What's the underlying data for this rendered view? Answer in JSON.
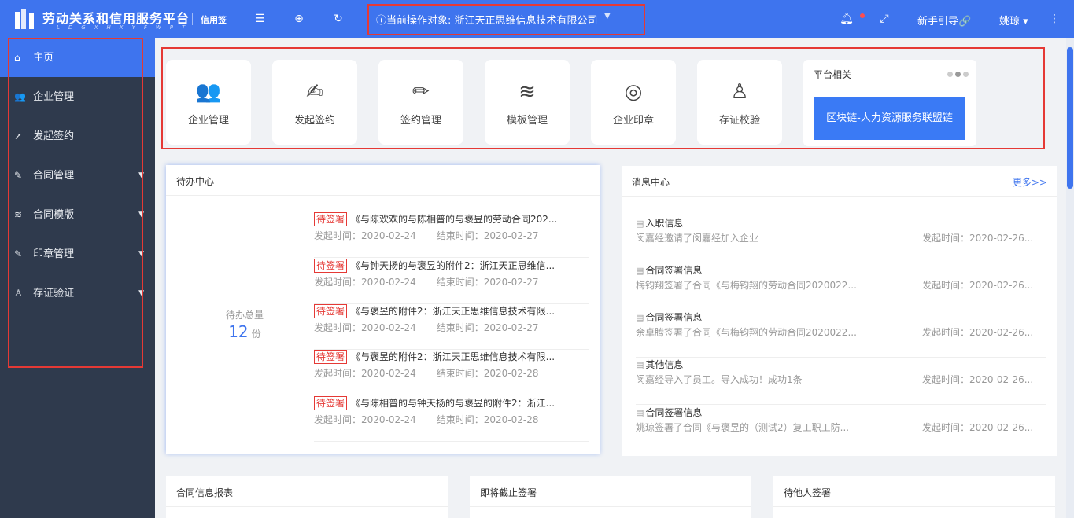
{
  "header": {
    "brand": "劳动关系和信用服务平台",
    "brand_sub": "LDGXHXYFWPT",
    "tag": "信用签",
    "target_label": "ⓘ当前操作对象:  浙江天正思维信息技术有限公司",
    "guide": "新手引导🔗",
    "user": "姚琼 ▾",
    "icons": [
      "menu-icon",
      "globe-icon",
      "refresh-icon",
      "bell-icon",
      "fullscreen-icon",
      "more-icon"
    ],
    "accent_color": "#3e74ee"
  },
  "sidebar": {
    "items": [
      {
        "label": "主页",
        "icon": "⌂"
      },
      {
        "label": "企业管理",
        "icon": "👥"
      },
      {
        "label": "发起签约",
        "icon": "➚"
      },
      {
        "label": "合同管理",
        "icon": "✎"
      },
      {
        "label": "合同模版",
        "icon": "≋"
      },
      {
        "label": "印章管理",
        "icon": "✎"
      },
      {
        "label": "存证验证",
        "icon": "♙"
      }
    ]
  },
  "quick": {
    "cards": [
      {
        "label": "企业管理",
        "icon": "👥"
      },
      {
        "label": "发起签约",
        "icon": "✍"
      },
      {
        "label": "签约管理",
        "icon": "✏"
      },
      {
        "label": "模板管理",
        "icon": "≋"
      },
      {
        "label": "企业印章",
        "icon": "◎"
      },
      {
        "label": "存证校验",
        "icon": "♙"
      }
    ],
    "platform_title": "平台相关",
    "platform_button": "区块链-人力资源服务联盟链"
  },
  "todo": {
    "title": "待办中心",
    "total_label": "待办总量",
    "total_count": "12",
    "unit": "份",
    "badge": "待签署",
    "items": [
      {
        "title": "《与陈欢欢的与陈相普的与褒昱的劳动合同202...",
        "start": "发起时间：2020-02-24",
        "end": "结束时间：2020-02-27"
      },
      {
        "title": "《与钟天扬的与褒昱的附件2：浙江天正思维信...",
        "start": "发起时间：2020-02-24",
        "end": "结束时间：2020-02-27"
      },
      {
        "title": "《与褒昱的附件2：浙江天正思维信息技术有限...",
        "start": "发起时间：2020-02-24",
        "end": "结束时间：2020-02-27"
      },
      {
        "title": "《与褒昱的附件2：浙江天正思维信息技术有限...",
        "start": "发起时间：2020-02-24",
        "end": "结束时间：2020-02-28"
      },
      {
        "title": "《与陈相普的与钟天扬的与褒昱的附件2：浙江...",
        "start": "发起时间：2020-02-24",
        "end": "结束时间：2020-02-28"
      }
    ]
  },
  "messages": {
    "title": "消息中心",
    "more": "更多>>",
    "items": [
      {
        "title": "入职信息",
        "desc": "闵嘉经邀请了闵嘉经加入企业",
        "time": "发起时间：2020-02-26..."
      },
      {
        "title": "合同签署信息",
        "desc": "梅钧翔签署了合同《与梅钧翔的劳动合同2020022...",
        "time": "发起时间：2020-02-26..."
      },
      {
        "title": "合同签署信息",
        "desc": "余卓腾签署了合同《与梅钧翔的劳动合同2020022...",
        "time": "发起时间：2020-02-26..."
      },
      {
        "title": "其他信息",
        "desc": "闵嘉经导入了员工。导入成功！成功1条",
        "time": "发起时间：2020-02-26..."
      },
      {
        "title": "合同签署信息",
        "desc": "姚琼签署了合同《与褒昱的（测试2）复工职工防...",
        "time": "发起时间：2020-02-26..."
      }
    ]
  },
  "bottom": {
    "panels": [
      "合同信息报表",
      "即将截止签署",
      "待他人签署"
    ]
  }
}
